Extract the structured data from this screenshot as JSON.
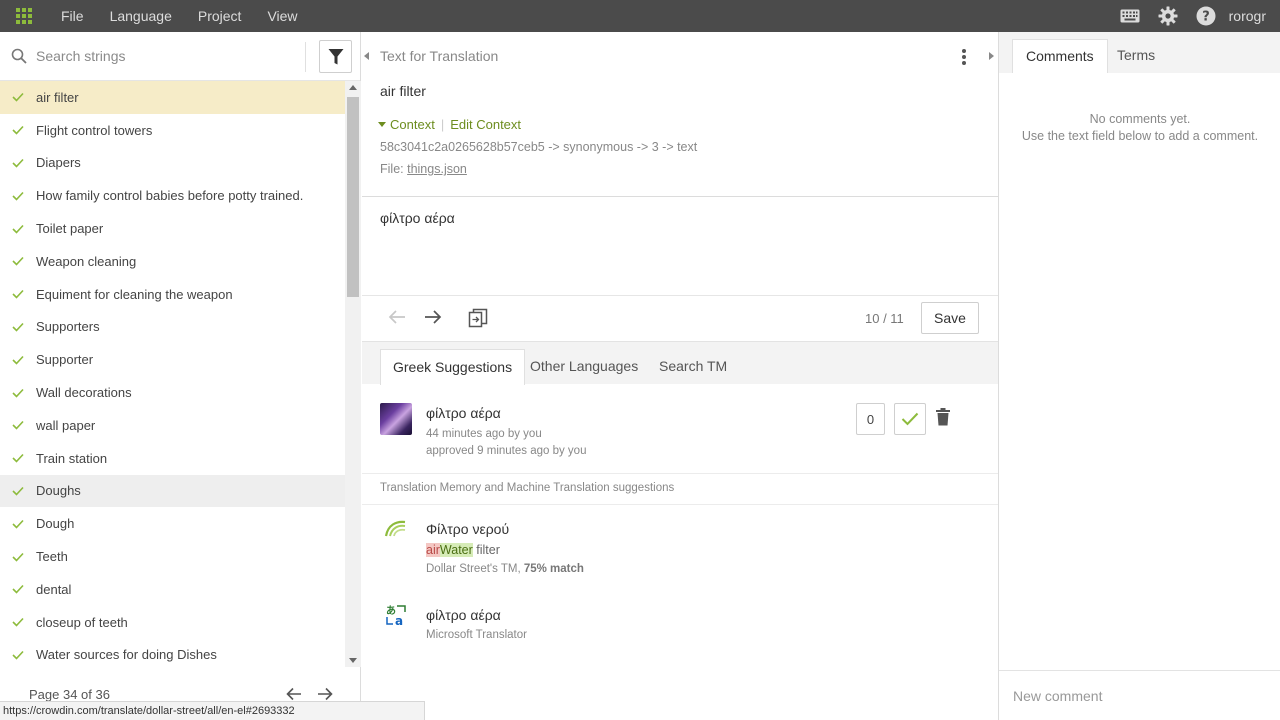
{
  "topbar": {
    "menu": [
      "File",
      "Language",
      "Project",
      "View"
    ],
    "username": "rorogr",
    "accent": "#8dbb3c"
  },
  "left": {
    "search_placeholder": "Search strings",
    "strings": [
      "air filter",
      "Flight control towers",
      "Diapers",
      "How family control babies before potty trained.",
      "Toilet paper",
      "Weapon cleaning",
      "Equiment for cleaning the weapon",
      "Supporters",
      "Supporter",
      "Wall decorations",
      "wall paper",
      "Train station",
      "Doughs",
      "Dough",
      "Teeth",
      "dental",
      "closeup of teeth",
      "Water sources for doing Dishes"
    ],
    "page_label": "Page 34 of 36"
  },
  "status_url": "https://crowdin.com/translate/dollar-street/all/en-el#2693332",
  "middle": {
    "header": "Text for Translation",
    "source_text": "air filter",
    "context_label": "Context",
    "edit_context_label": "Edit Context",
    "context_key": "58c3041c2a0265628b57ceb5 -> synonymous -> 3 -> text",
    "file_label": "File:",
    "file_name": "things.json",
    "translation_value": "φίλτρο αέρα",
    "counter": "10 / 11",
    "save_label": "Save",
    "tabs": [
      "Greek Suggestions",
      "Other Languages",
      "Search TM"
    ],
    "suggestion": {
      "text": "φίλτρο αέρα",
      "meta1": "44 minutes ago by you",
      "meta2": "approved 9 minutes ago by you",
      "votes": "0"
    },
    "tm_header": "Translation Memory and Machine Translation suggestions",
    "tm": {
      "text": "Φίλτρο νερού",
      "diff_del": "air",
      "diff_ins": "Water",
      "diff_rest": " filter",
      "source_name": "Dollar Street's TM, ",
      "source_match": "75% match"
    },
    "mt": {
      "text": "φίλτρο αέρα",
      "source": "Microsoft Translator"
    }
  },
  "right": {
    "tabs": [
      "Comments",
      "Terms"
    ],
    "no_comments_line1": "No comments yet.",
    "no_comments_line2": "Use the text field below to add a comment.",
    "comment_placeholder": "New comment"
  }
}
